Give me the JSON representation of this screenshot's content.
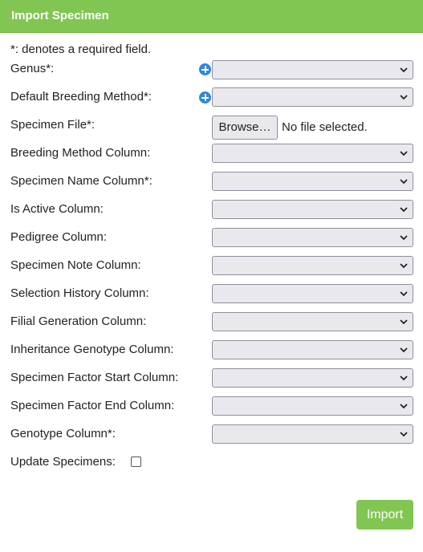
{
  "header": {
    "title": "Import Specimen"
  },
  "required_note": "*: denotes a required field.",
  "fields": {
    "genus": {
      "label": "Genus*:",
      "value": ""
    },
    "default_breeding_method": {
      "label": "Default Breeding Method*:",
      "value": ""
    },
    "specimen_file": {
      "label": "Specimen File*:",
      "browse_label": "Browse…",
      "status": "No file selected."
    },
    "breeding_method_column": {
      "label": "Breeding Method Column:",
      "value": ""
    },
    "specimen_name_column": {
      "label": "Specimen Name Column*:",
      "value": ""
    },
    "is_active_column": {
      "label": "Is Active Column:",
      "value": ""
    },
    "pedigree_column": {
      "label": "Pedigree Column:",
      "value": ""
    },
    "specimen_note_column": {
      "label": "Specimen Note Column:",
      "value": ""
    },
    "selection_history_column": {
      "label": "Selection History Column:",
      "value": ""
    },
    "filial_generation_column": {
      "label": "Filial Generation Column:",
      "value": ""
    },
    "inheritance_genotype_column": {
      "label": "Inheritance Genotype Column:",
      "value": ""
    },
    "specimen_factor_start_column": {
      "label": "Specimen Factor Start Column:",
      "value": ""
    },
    "specimen_factor_end_column": {
      "label": "Specimen Factor End Column:",
      "value": ""
    },
    "genotype_column": {
      "label": "Genotype Column*:",
      "value": ""
    },
    "update_specimens": {
      "label": "Update Specimens:",
      "checked": false
    }
  },
  "actions": {
    "import_label": "Import"
  },
  "colors": {
    "accent": "#81c652",
    "add_icon": "#2e86de"
  },
  "icons": {
    "add": "plus-circle-icon",
    "dropdown": "chevron-down-icon"
  }
}
